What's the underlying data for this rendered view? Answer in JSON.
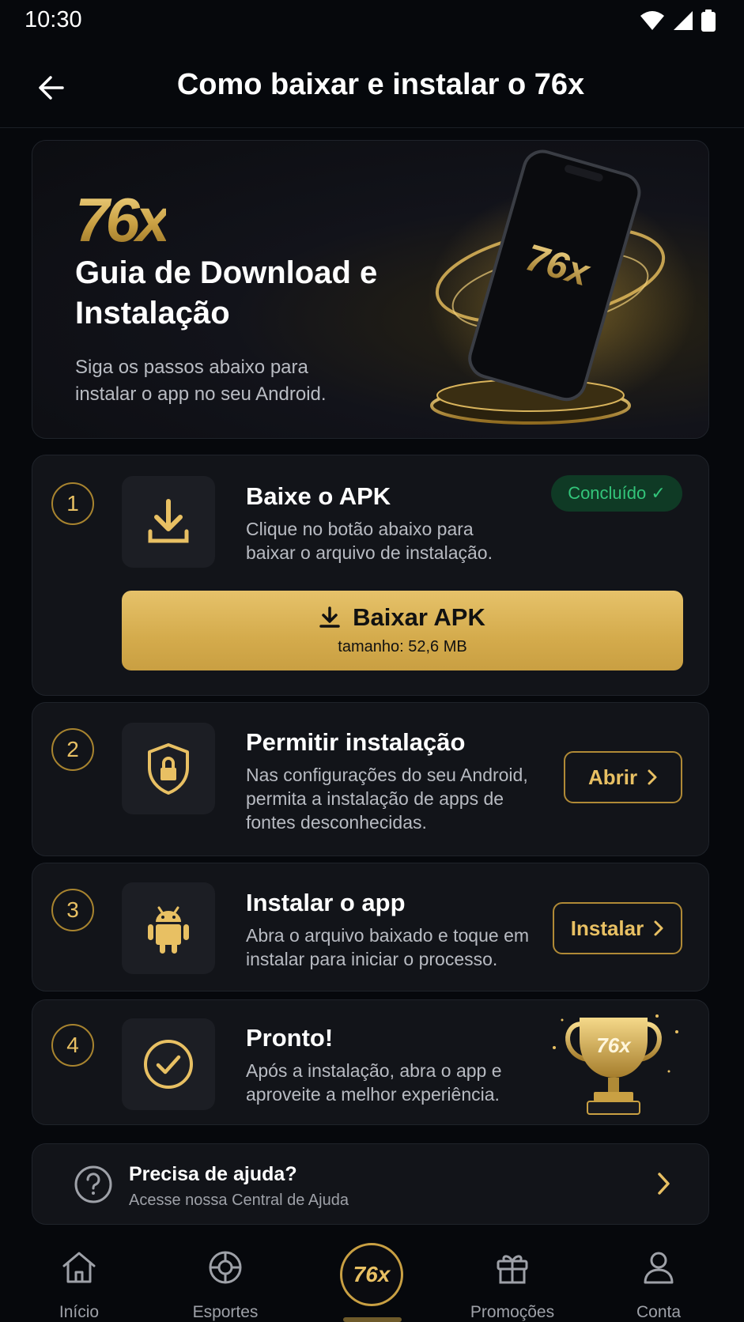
{
  "status_bar": {
    "time": "10:30"
  },
  "app_bar": {
    "title": "Como baixar e instalar o 76x"
  },
  "hero": {
    "logo": "76x",
    "title": "Guia de Download e Instalação",
    "subtitle": "Siga os passos abaixo para instalar o app no seu Android.",
    "phone_logo": "76x"
  },
  "steps": [
    {
      "number": "1",
      "title": "Baixe o APK",
      "description": "Clique no botão abaixo para baixar o arquivo de instalação.",
      "badge": "Concluído ✓",
      "button_label": "Baixar APK",
      "button_sub": "tamanho: 52,6 MB",
      "icon": "download-icon"
    },
    {
      "number": "2",
      "title": "Permitir instalação",
      "description": "Nas configurações do seu Android, permita a instalação de apps de fontes desconhecidas.",
      "button_label": "Abrir",
      "icon": "shield-lock-icon"
    },
    {
      "number": "3",
      "title": "Instalar o app",
      "description": "Abra o arquivo baixado e toque em instalar para iniciar o processo.",
      "button_label": "Instalar",
      "icon": "android-icon"
    },
    {
      "number": "4",
      "title": "Pronto!",
      "description": "Após a instalação, abra o app e aproveite a melhor experiência.",
      "trophy_label": "76x",
      "icon": "check-circle-icon"
    }
  ],
  "help": {
    "title": "Precisa de ajuda?",
    "subtitle": "Acesse nossa Central de Ajuda"
  },
  "bottom_nav": {
    "items": [
      {
        "label": "Início",
        "icon": "home-icon"
      },
      {
        "label": "Esportes",
        "icon": "sports-ball-icon"
      },
      {
        "label": "76x",
        "icon": "logo"
      },
      {
        "label": "Promoções",
        "icon": "gift-icon"
      },
      {
        "label": "Conta",
        "icon": "user-icon"
      }
    ]
  },
  "colors": {
    "background": "#06080c",
    "card": "#121419",
    "gold": "#e8c063",
    "success": "#33c57a"
  }
}
